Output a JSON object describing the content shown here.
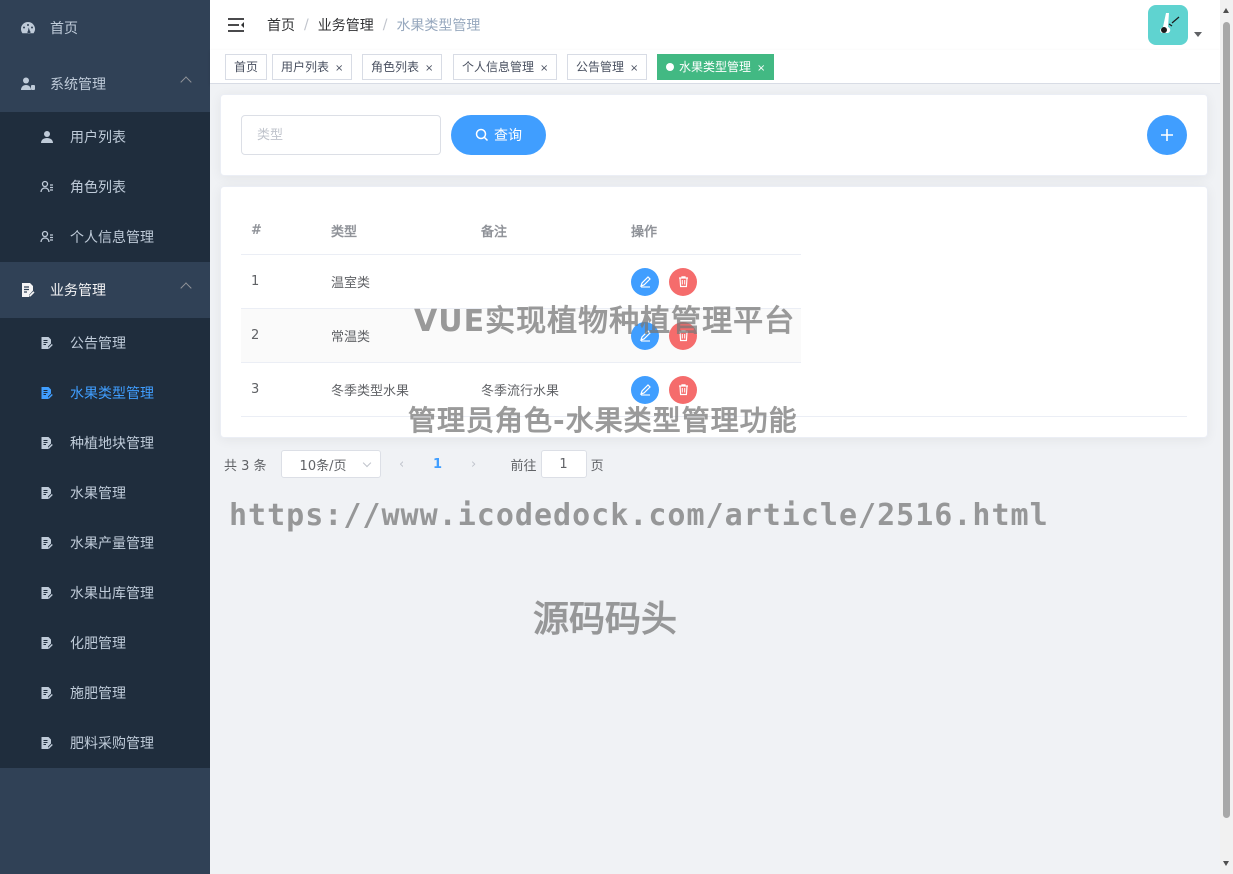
{
  "sidebar": {
    "home": "首页",
    "system": {
      "title": "系统管理",
      "items": [
        "用户列表",
        "角色列表",
        "个人信息管理"
      ]
    },
    "business": {
      "title": "业务管理",
      "items": [
        "公告管理",
        "水果类型管理",
        "种植地块管理",
        "水果管理",
        "水果产量管理",
        "水果出库管理",
        "化肥管理",
        "施肥管理",
        "肥料采购管理"
      ]
    }
  },
  "breadcrumb": [
    "首页",
    "业务管理",
    "水果类型管理"
  ],
  "tags": [
    "首页",
    "用户列表",
    "角色列表",
    "个人信息管理",
    "公告管理",
    "水果类型管理"
  ],
  "search": {
    "placeholder": "类型",
    "query_label": "查询"
  },
  "table": {
    "headers": [
      "#",
      "类型",
      "备注",
      "操作"
    ],
    "rows": [
      {
        "id": "1",
        "type": "温室类",
        "note": ""
      },
      {
        "id": "2",
        "type": "常温类",
        "note": ""
      },
      {
        "id": "3",
        "type": "冬季类型水果",
        "note": "冬季流行水果"
      }
    ]
  },
  "pagination": {
    "total": "共 3 条",
    "page_size": "10条/页",
    "current": "1",
    "goto_prefix": "前往",
    "goto_value": "1",
    "goto_suffix": "页"
  },
  "watermarks": {
    "line1": "VUE实现植物种植管理平台",
    "line2": "管理员角色-水果类型管理功能",
    "url": "https://www.icodedock.com/article/2516.html",
    "brand": "源码码头"
  },
  "colors": {
    "sidebar": "#304156",
    "submenu": "#1f2d3d",
    "primary": "#409eff",
    "danger": "#f56c6c",
    "tag_active": "#42b983"
  }
}
